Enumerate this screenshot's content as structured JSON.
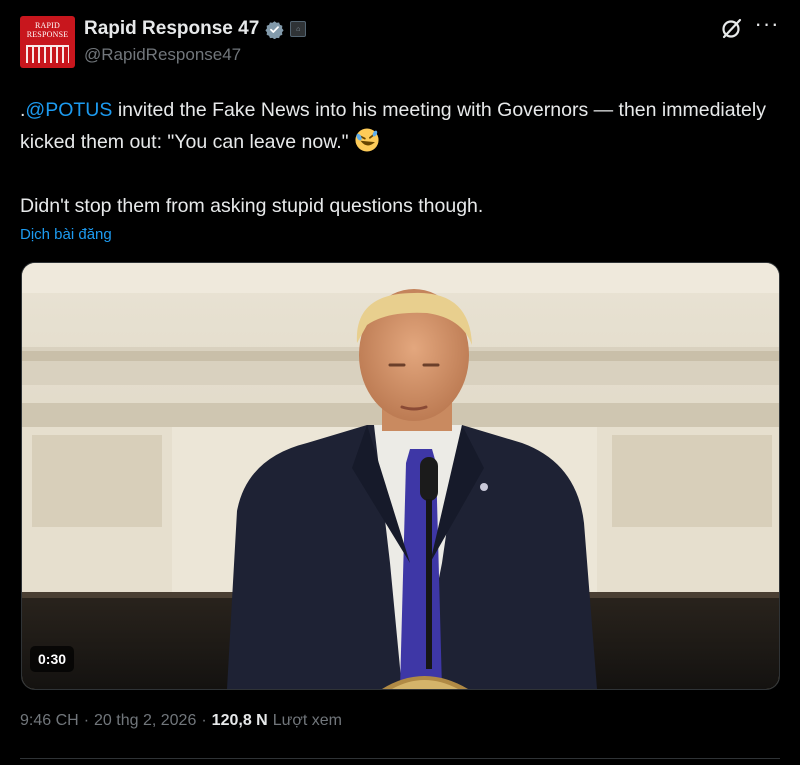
{
  "author": {
    "display_name": "Rapid Response 47",
    "handle": "@RapidResponse47",
    "avatar_text": "RAPID\nRESPONSE"
  },
  "tweet": {
    "prefix": ".",
    "mention": "@POTUS",
    "line1_rest": " invited the Fake News into his meeting with Governors — then immediately kicked them out: \"You can leave now.\" ",
    "emoji": "rolling-on-floor-laughing-emoji",
    "line2": "Didn't stop them from asking stupid questions though.",
    "translate_label": "Dịch bài đăng"
  },
  "media": {
    "type": "video",
    "duration": "0:30"
  },
  "meta": {
    "time": "9:46 CH",
    "separator1": "·",
    "date": "20 thg 2, 2026",
    "separator2": "·",
    "views_count": "120,8 N",
    "views_label": "Lượt xem"
  },
  "colors": {
    "background": "#000000",
    "text": "#e7e9ea",
    "secondary": "#71767b",
    "link": "#1d9bf0",
    "avatar_red": "#c8161d"
  }
}
